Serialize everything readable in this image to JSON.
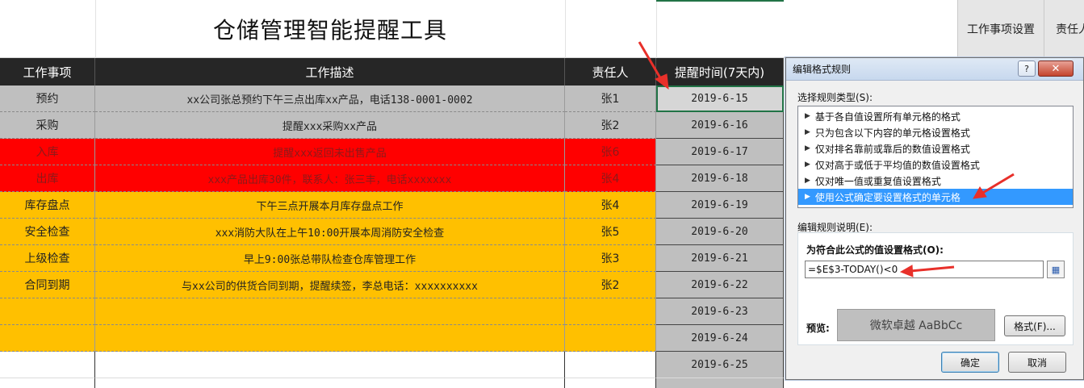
{
  "sheet": {
    "title": "仓储管理智能提醒工具",
    "side_headers": [
      "工作事项设置",
      "责任人"
    ],
    "headers": [
      "工作事项",
      "工作描述",
      "责任人",
      "提醒时间(7天内)"
    ],
    "rows": [
      {
        "item": "预约",
        "desc": "xx公司张总预约下午三点出库xx产品，电话138-0001-0002",
        "owner": "张1",
        "date": "2019-6-15",
        "color": "gray"
      },
      {
        "item": "采购",
        "desc": "提醒xxx采购xx产品",
        "owner": "张2",
        "date": "2019-6-16",
        "color": "gray"
      },
      {
        "item": "入库",
        "desc": "提醒xxx返回未出售产品",
        "owner": "张6",
        "date": "2019-6-17",
        "color": "red"
      },
      {
        "item": "出库",
        "desc": "xxx产品出库30件，联系人：张三丰，电话xxxxxxx",
        "owner": "张4",
        "date": "2019-6-18",
        "color": "red"
      },
      {
        "item": "库存盘点",
        "desc": "下午三点开展本月库存盘点工作",
        "owner": "张4",
        "date": "2019-6-19",
        "color": "orange"
      },
      {
        "item": "安全检查",
        "desc": "xxx消防大队在上午10:00开展本周消防安全检查",
        "owner": "张5",
        "date": "2019-6-20",
        "color": "orange"
      },
      {
        "item": "上级检查",
        "desc": "早上9:00张总带队检查仓库管理工作",
        "owner": "张3",
        "date": "2019-6-21",
        "color": "orange"
      },
      {
        "item": "合同到期",
        "desc": "与xx公司的供货合同到期，提醒续签，李总电话：xxxxxxxxxx",
        "owner": "张2",
        "date": "2019-6-22",
        "color": "orange"
      },
      {
        "item": "",
        "desc": "",
        "owner": "",
        "date": "2019-6-23",
        "color": "orange"
      },
      {
        "item": "",
        "desc": "",
        "owner": "",
        "date": "2019-6-24",
        "color": "orange"
      },
      {
        "item": "",
        "desc": "",
        "owner": "",
        "date": "2019-6-25",
        "color": "white"
      },
      {
        "item": "",
        "desc": "",
        "owner": "",
        "date": "",
        "color": "white"
      }
    ],
    "colors": {
      "gray": "#bfbfbf",
      "red": "#ff0000",
      "orange": "#ffc000",
      "header": "#262626"
    }
  },
  "dialog": {
    "title": "编辑格式规则",
    "help": "?",
    "close": "✕",
    "select_type_label": "选择规则类型(S):",
    "rule_types": [
      "基于各自值设置所有单元格的格式",
      "只为包含以下内容的单元格设置格式",
      "仅对排名靠前或靠后的数值设置格式",
      "仅对高于或低于平均值的数值设置格式",
      "仅对唯一值或重复值设置格式",
      "使用公式确定要设置格式的单元格"
    ],
    "selected_rule_index": 5,
    "edit_desc_label": "编辑规则说明(E):",
    "formula_label": "为符合此公式的值设置格式(O):",
    "formula_value": "=$E$3-TODAY()<0",
    "preview_label": "预览:",
    "preview_text": "微软卓越  AaBbCc",
    "format_button": "格式(F)...",
    "ok_button": "确定",
    "cancel_button": "取消"
  }
}
